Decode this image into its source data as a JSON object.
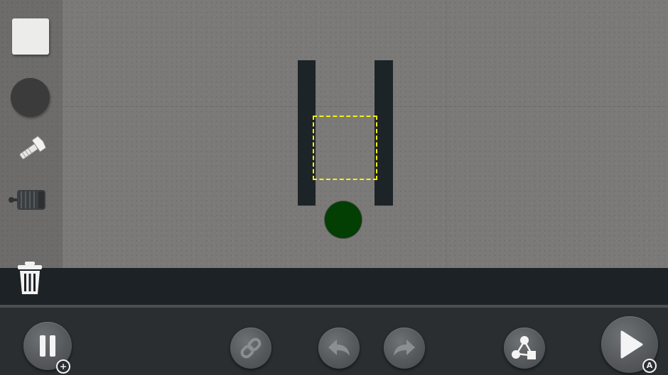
{
  "colors": {
    "background": "#7b7a78",
    "wall": "#1d2428",
    "ball": "#033e03",
    "goal_outline": "#f7f00c",
    "toolbar": "#2a2e31"
  },
  "palette": {
    "tools": [
      {
        "name": "square-block",
        "icon": "square-icon"
      },
      {
        "name": "circle-block",
        "icon": "circle-icon"
      },
      {
        "name": "bolt",
        "icon": "bolt-icon"
      },
      {
        "name": "motor",
        "icon": "motor-icon"
      }
    ],
    "delete_icon": "trash-icon"
  },
  "toolbar": {
    "pause_icon": "pause-icon",
    "pause_badge": "+",
    "link_icon": "link-icon",
    "undo_icon": "undo-icon",
    "redo_icon": "redo-icon",
    "structure_icon": "shapes-icon",
    "play_icon": "play-icon",
    "play_badge": "A"
  }
}
